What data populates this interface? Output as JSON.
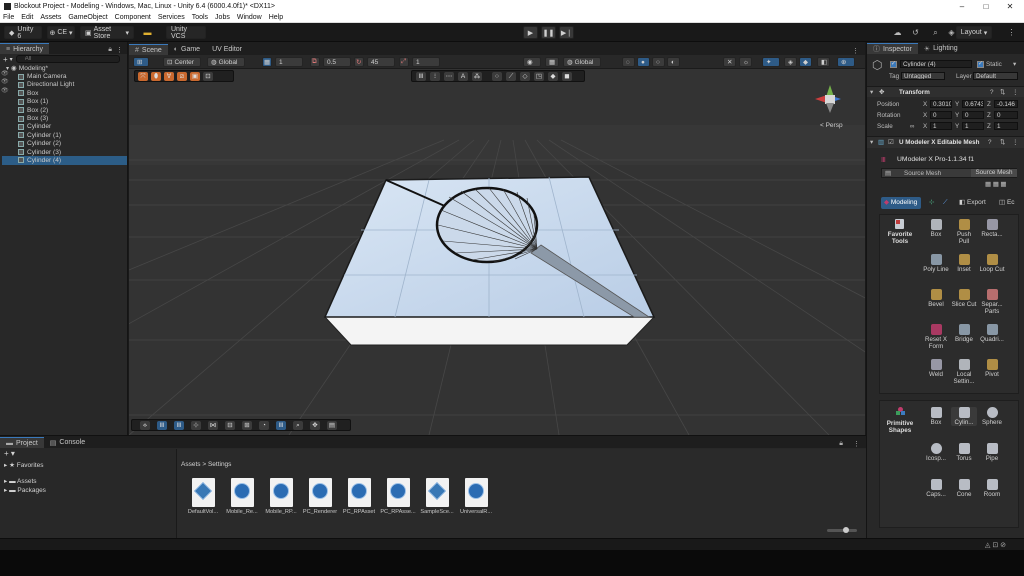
{
  "window": {
    "title": "Blockout Project - Modeling - Windows, Mac, Linux - Unity 6.4 (6000.4.0f1)* <DX11>"
  },
  "menu": [
    "File",
    "Edit",
    "Assets",
    "GameObject",
    "Component",
    "Services",
    "Tools",
    "Jobs",
    "Window",
    "Help"
  ],
  "toolbar": {
    "unity_label": "Unity 6",
    "ce_label": "CE",
    "asset_store_label": "Asset Store",
    "vcs_label": "Unity VCS",
    "layout_label": "Layout"
  },
  "hierarchy": {
    "tab": "Hierarchy",
    "search_placeholder": "All",
    "scene_name": "Modeling*",
    "items": [
      {
        "label": "Main Camera"
      },
      {
        "label": "Directional Light"
      },
      {
        "label": "Box"
      },
      {
        "label": "Box (1)"
      },
      {
        "label": "Box (2)"
      },
      {
        "label": "Box (3)"
      },
      {
        "label": "Cylinder"
      },
      {
        "label": "Cylinder (1)"
      },
      {
        "label": "Cylinder (2)"
      },
      {
        "label": "Cylinder (3)"
      },
      {
        "label": "Cylinder (4)",
        "selected": true
      }
    ]
  },
  "center_tabs": [
    "Scene",
    "Game",
    "UV Editor"
  ],
  "scene_toolbar": {
    "pivot": "Center",
    "space": "Global",
    "grid_value": "1",
    "snap_value": "0.5",
    "angle_value": "45",
    "scale_value": "1",
    "space2": "Global",
    "persp_label": "< Persp"
  },
  "inspector": {
    "tabs": [
      "Inspector",
      "Lighting"
    ],
    "object_name": "Cylinder (4)",
    "static_label": "Static",
    "tag_label": "Tag",
    "tag_value": "Untagged",
    "layer_label": "Layer",
    "layer_value": "Default",
    "transform_title": "Transform",
    "position_label": "Position",
    "rotation_label": "Rotation",
    "scale_label": "Scale",
    "position": {
      "x": "0.3010",
      "y": "0.6743",
      "z": "-0.146"
    },
    "rotation": {
      "x": "0",
      "y": "0",
      "z": "0"
    },
    "scale": {
      "x": "1",
      "y": "1",
      "z": "1"
    },
    "umodeler_component": "U Modeler X Editable Mesh",
    "umodeler_version": "UModeler X Pro-1.1.34 f1",
    "source_mesh_label": "Source Mesh",
    "source_mesh_button": "Source Mesh",
    "mode_tabs": [
      "Modeling",
      "Export",
      "Ec"
    ],
    "favorite_tools_label": "Favorite Tools",
    "tools": [
      {
        "label": "Box",
        "icon": "box-icon"
      },
      {
        "label": "Push Pull",
        "icon": "push-pull-icon"
      },
      {
        "label": "Recta...",
        "icon": "rectangle-icon"
      },
      {
        "label": "Poly Line",
        "icon": "polyline-icon"
      },
      {
        "label": "Inset",
        "icon": "inset-icon"
      },
      {
        "label": "Loop Cut",
        "icon": "loop-cut-icon"
      },
      {
        "label": "Bevel",
        "icon": "bevel-icon"
      },
      {
        "label": "Slice Cut",
        "icon": "slice-cut-icon"
      },
      {
        "label": "Separ... Parts",
        "icon": "separate-parts-icon"
      },
      {
        "label": "Reset X Form",
        "icon": "reset-xform-icon"
      },
      {
        "label": "Bridge",
        "icon": "bridge-icon"
      },
      {
        "label": "Quadri...",
        "icon": "quadrilateral-icon"
      },
      {
        "label": "Weld",
        "icon": "weld-icon"
      },
      {
        "label": "Local Settin...",
        "icon": "local-settings-icon"
      },
      {
        "label": "Pivot",
        "icon": "pivot-icon"
      }
    ],
    "primitive_shapes_label": "Primitive Shapes",
    "primitives": [
      {
        "label": "Box"
      },
      {
        "label": "Cylin..."
      },
      {
        "label": "Sphere"
      },
      {
        "label": "Icosp..."
      },
      {
        "label": "Torus"
      },
      {
        "label": "Pipe"
      },
      {
        "label": "Caps..."
      },
      {
        "label": "Cone"
      },
      {
        "label": "Room"
      }
    ]
  },
  "project": {
    "tabs": [
      "Project",
      "Console"
    ],
    "favorites_label": "Favorites",
    "tree": [
      "Assets",
      "Packages"
    ],
    "breadcrumb": [
      "Assets",
      "Settings"
    ],
    "count": "28",
    "assets": [
      {
        "label": "DefaultVol...",
        "kind": "cube"
      },
      {
        "label": "Mobile_Re...",
        "kind": "circle"
      },
      {
        "label": "Mobile_RP...",
        "kind": "circle"
      },
      {
        "label": "PC_Renderer",
        "kind": "circle"
      },
      {
        "label": "PC_RPAsset",
        "kind": "circle"
      },
      {
        "label": "PC_RPAsse...",
        "kind": "circle"
      },
      {
        "label": "SampleSce...",
        "kind": "cube"
      },
      {
        "label": "UniversalR...",
        "kind": "circle"
      }
    ]
  }
}
